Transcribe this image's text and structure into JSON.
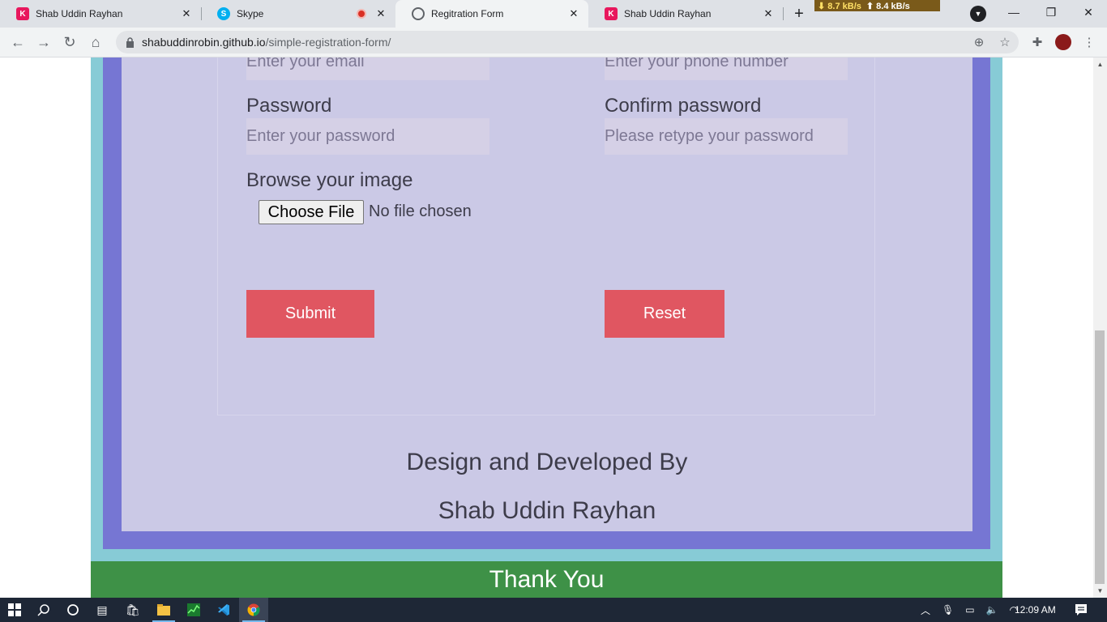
{
  "browser": {
    "tabs": [
      {
        "title": "Shab Uddin Rayhan",
        "favicon": "k-logo-icon"
      },
      {
        "title": "Skype",
        "favicon": "skype-icon",
        "recording": true
      },
      {
        "title": "Regitration Form",
        "favicon": "globe-icon",
        "active": true
      },
      {
        "title": "Shab Uddin Rayhan",
        "favicon": "k-logo-icon"
      }
    ],
    "net_speed": {
      "down": "8.7 kB/s",
      "up": "8.4 kB/s"
    },
    "url_host": "shabuddinrobin.github.io",
    "url_path": "/simple-registration-form/"
  },
  "form": {
    "email_placeholder": "Enter your email",
    "phone_placeholder": "Enter your phone number",
    "password_label": "Password",
    "password_placeholder": "Enter your password",
    "confirm_label": "Confirm password",
    "confirm_placeholder": "Please retype your password",
    "image_label": "Browse your image",
    "file_button": "Choose File",
    "file_status": "No file chosen",
    "submit": "Submit",
    "reset": "Reset"
  },
  "credits": {
    "line1": "Design and Developed By",
    "line2": "Shab Uddin Rayhan"
  },
  "footer": "Thank You",
  "taskbar": {
    "time": "12:09 AM"
  },
  "colors": {
    "teal": "#87cbd6",
    "purple": "#7676d3",
    "lavender": "#cbc9e6",
    "button": "#e05661",
    "footer": "#3e9147"
  }
}
